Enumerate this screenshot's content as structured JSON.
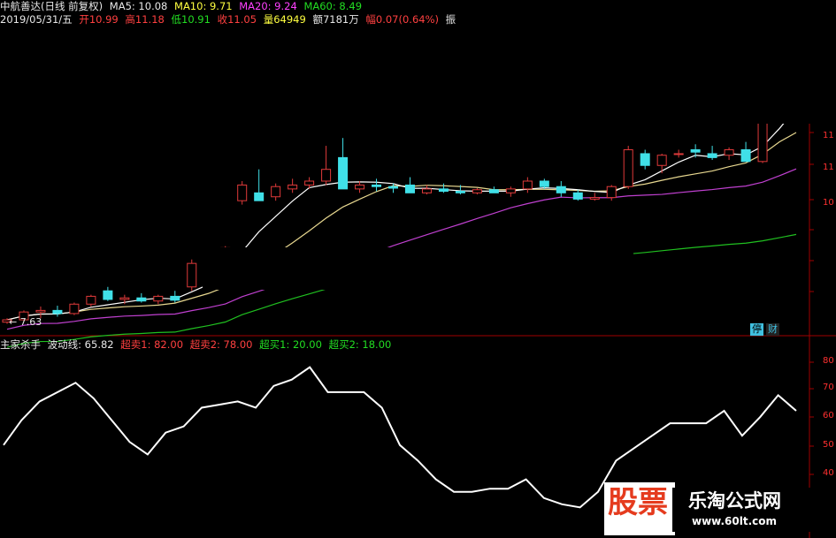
{
  "header": {
    "stock_title": "中航善达(日线 前复权)",
    "ma5": "MA5: 10.08",
    "ma10": "MA10: 9.71",
    "ma20": "MA20: 9.24",
    "ma60": "MA60: 8.49",
    "date": "2019/05/31/五",
    "open": "开10.99",
    "high": "高11.18",
    "low": "低10.91",
    "close": "收11.05",
    "volume": "量64949",
    "amount": "额7181万",
    "change": "幅0.07(0.64%)",
    "amplitude": "振"
  },
  "price_panel": {
    "low_marker": "7.63",
    "badge_stop": "停",
    "badge_fin": "财"
  },
  "indicator": {
    "name": "主家杀手",
    "wave": "波动线: 65.82",
    "sell1": "超卖1: 82.00",
    "sell2": "超卖2: 78.00",
    "buy1": "超买1: 20.00",
    "buy2": "超买2: 18.00"
  },
  "right_axis": {
    "price_ticks": [
      "11",
      "11",
      "10"
    ],
    "ind_ticks": [
      "80",
      "70",
      "60",
      "50",
      "40"
    ]
  },
  "watermark": {
    "logo_text": "股票",
    "site_name": "乐淘公式网",
    "site_url": "www.60lt.com"
  },
  "colors": {
    "up": "#e03a3a",
    "down": "#40e0e8",
    "ma5": "#ffffff",
    "ma10": "#e8d890",
    "ma20": "#c040d0",
    "ma60": "#20c020",
    "wave": "#ffffff",
    "axis": "#a00000"
  },
  "chart_data": {
    "type": "line",
    "candles_ohlc": [
      [
        7.65,
        7.7,
        7.63,
        7.68
      ],
      [
        7.68,
        7.8,
        7.66,
        7.78
      ],
      [
        7.78,
        7.85,
        7.7,
        7.8
      ],
      [
        7.8,
        7.86,
        7.72,
        7.76
      ],
      [
        7.76,
        7.9,
        7.74,
        7.88
      ],
      [
        7.88,
        8.0,
        7.85,
        7.98
      ],
      [
        8.05,
        8.1,
        7.92,
        7.94
      ],
      [
        7.94,
        8.0,
        7.88,
        7.96
      ],
      [
        7.96,
        8.02,
        7.9,
        7.92
      ],
      [
        7.92,
        8.0,
        7.88,
        7.98
      ],
      [
        7.98,
        8.05,
        7.9,
        7.93
      ],
      [
        8.1,
        8.45,
        8.05,
        8.4
      ],
      [
        8.4,
        8.55,
        8.35,
        8.42
      ],
      [
        8.42,
        8.62,
        8.4,
        8.6
      ],
      [
        9.2,
        9.45,
        9.15,
        9.4
      ],
      [
        9.3,
        9.6,
        9.25,
        9.2
      ],
      [
        9.25,
        9.42,
        9.2,
        9.38
      ],
      [
        9.35,
        9.48,
        9.3,
        9.4
      ],
      [
        9.4,
        9.5,
        9.35,
        9.45
      ],
      [
        9.45,
        9.9,
        9.4,
        9.6
      ],
      [
        9.75,
        10.0,
        9.7,
        9.35
      ],
      [
        9.35,
        9.45,
        9.3,
        9.4
      ],
      [
        9.4,
        9.48,
        9.32,
        9.38
      ],
      [
        9.38,
        9.42,
        9.3,
        9.36
      ],
      [
        9.4,
        9.5,
        9.38,
        9.3
      ],
      [
        9.3,
        9.4,
        9.28,
        9.35
      ],
      [
        9.35,
        9.42,
        9.3,
        9.32
      ],
      [
        9.32,
        9.4,
        9.28,
        9.3
      ],
      [
        9.3,
        9.36,
        9.28,
        9.34
      ],
      [
        9.34,
        9.38,
        9.3,
        9.3
      ],
      [
        9.3,
        9.38,
        9.25,
        9.35
      ],
      [
        9.35,
        9.5,
        9.3,
        9.45
      ],
      [
        9.45,
        9.48,
        9.35,
        9.38
      ],
      [
        9.38,
        9.45,
        9.25,
        9.3
      ],
      [
        9.3,
        9.34,
        9.2,
        9.22
      ],
      [
        9.22,
        9.3,
        9.2,
        9.24
      ],
      [
        9.24,
        9.4,
        9.2,
        9.38
      ],
      [
        9.38,
        9.9,
        9.35,
        9.85
      ],
      [
        9.8,
        9.85,
        9.6,
        9.65
      ],
      [
        9.65,
        9.8,
        9.55,
        9.78
      ],
      [
        9.8,
        9.85,
        9.75,
        9.8
      ],
      [
        9.85,
        9.92,
        9.75,
        9.82
      ],
      [
        9.8,
        9.9,
        9.72,
        9.75
      ],
      [
        9.78,
        9.88,
        9.72,
        9.85
      ],
      [
        9.85,
        9.95,
        9.8,
        9.7
      ],
      [
        9.7,
        10.4,
        9.68,
        10.35
      ],
      [
        10.4,
        11.0,
        10.35,
        10.95
      ],
      [
        10.99,
        11.18,
        10.91,
        11.05
      ]
    ],
    "wave_line": [
      55,
      63,
      69,
      72,
      75,
      70,
      63,
      56,
      52,
      59,
      61,
      67,
      68,
      69,
      67,
      74,
      76,
      80,
      72,
      72,
      72,
      67,
      55,
      50,
      44,
      40,
      40,
      41,
      41,
      44,
      38,
      36,
      35,
      40,
      50,
      54,
      58,
      62,
      62,
      62,
      66,
      58,
      64,
      71,
      66
    ],
    "ylim_price": [
      7.5,
      11.4
    ],
    "ylim_ind": [
      30,
      85
    ]
  }
}
